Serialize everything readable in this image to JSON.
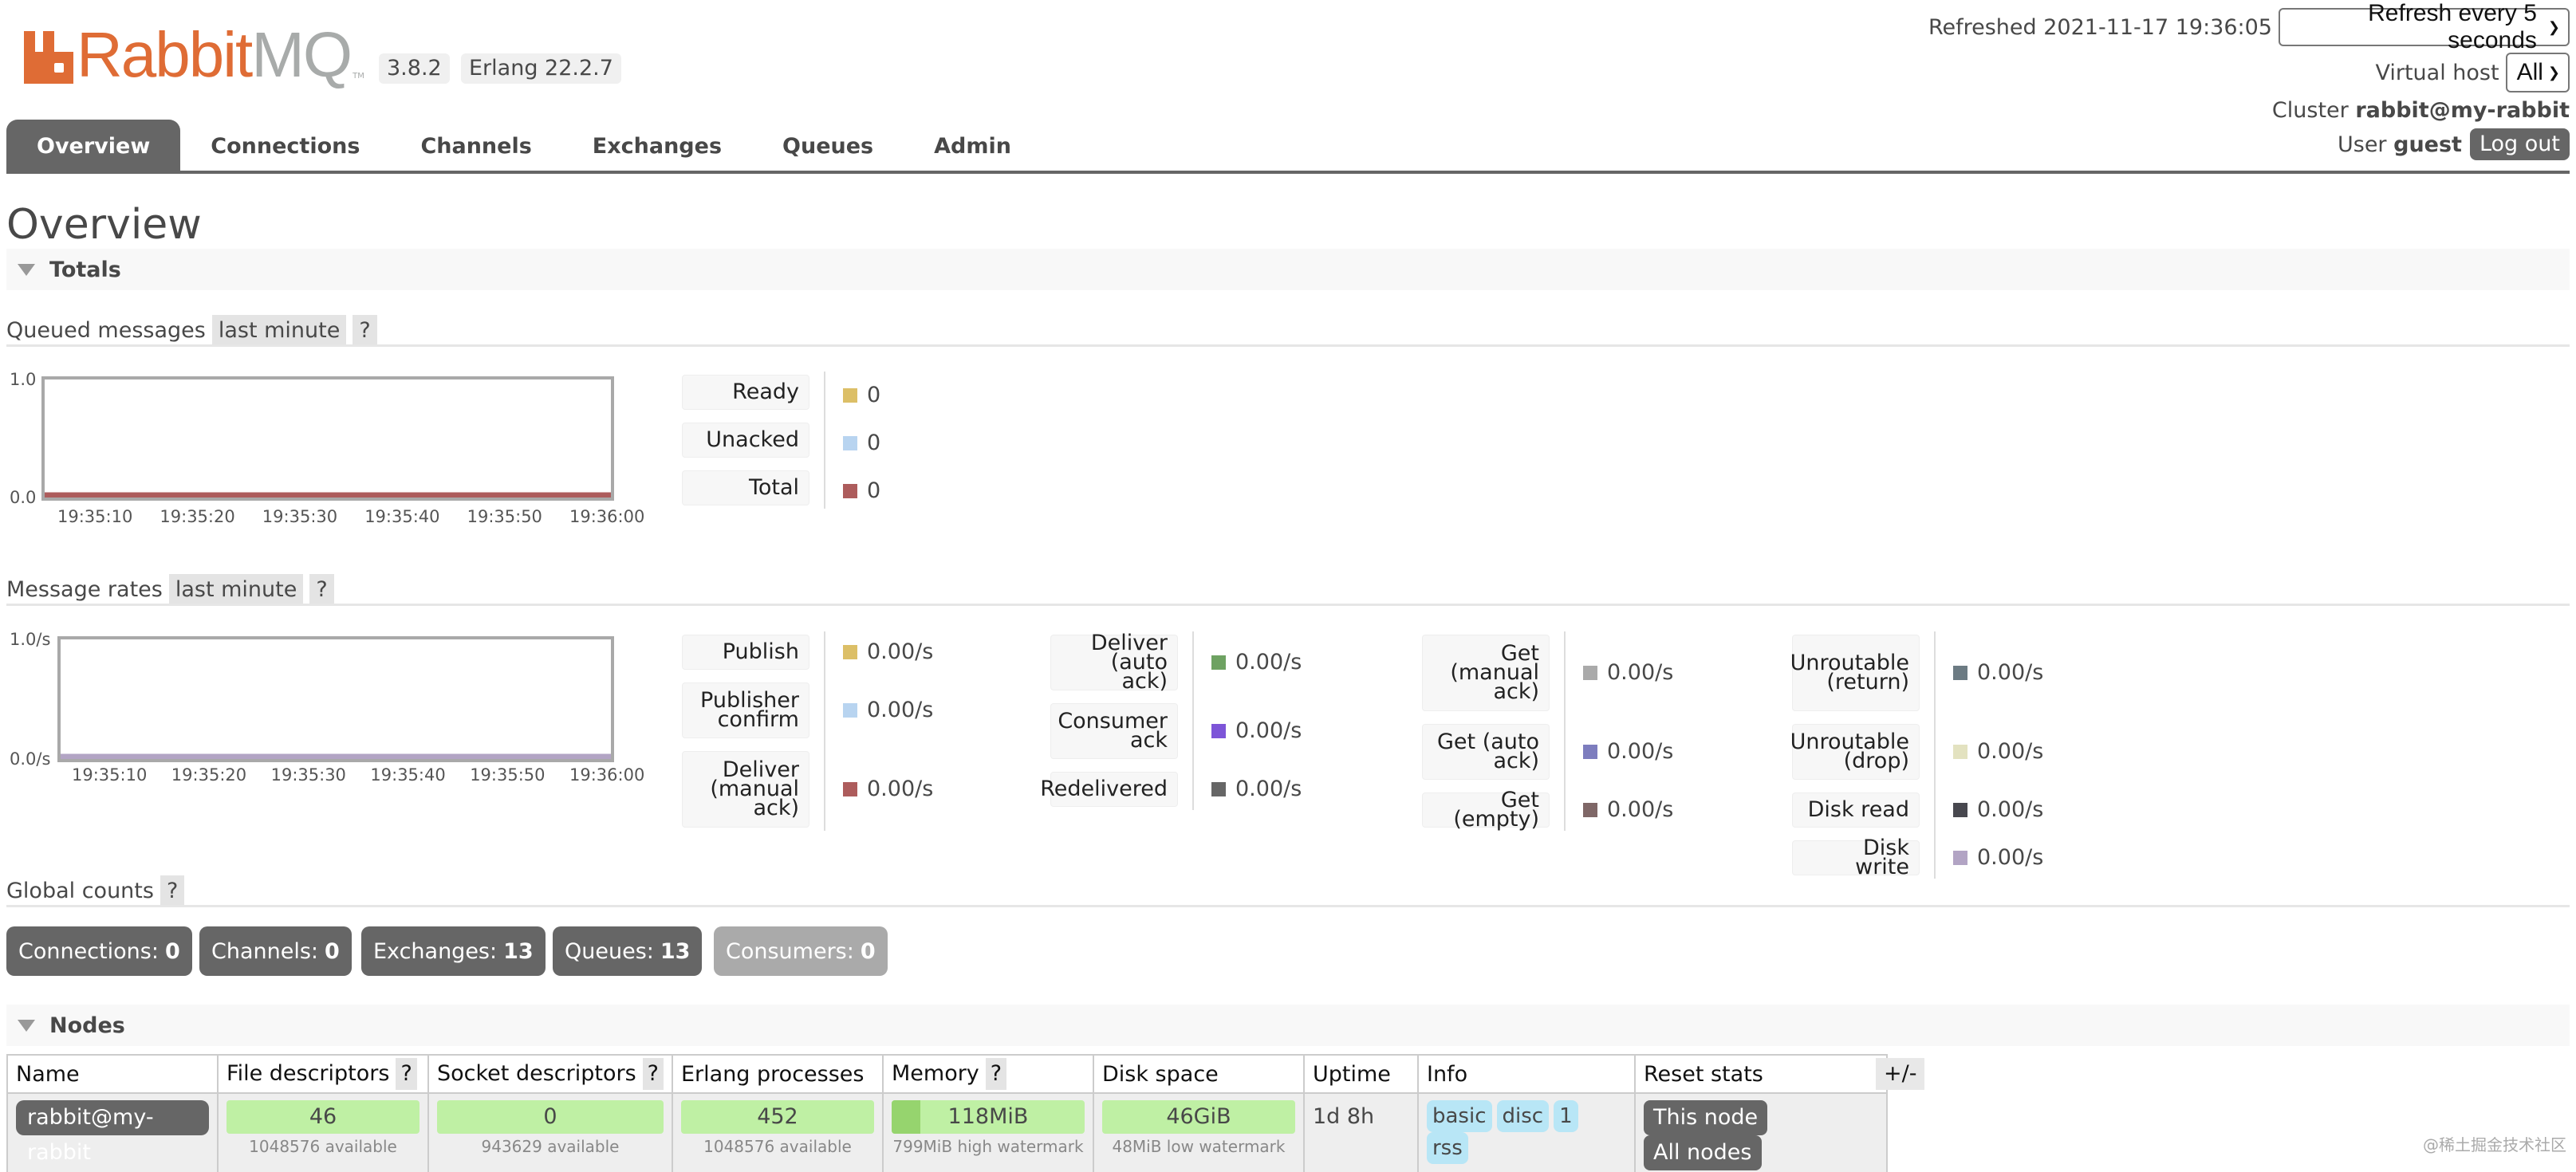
{
  "header": {
    "logo_primary": "Rabbit",
    "logo_secondary": "MQ",
    "logo_tm": "TM",
    "version": "3.8.2",
    "erlang": "Erlang 22.2.7",
    "refreshed": "Refreshed 2021-11-17 19:36:05",
    "refresh_select": "Refresh every 5 seconds",
    "vhost_label": "Virtual host",
    "vhost_select": "All",
    "cluster_label": "Cluster",
    "cluster_name": "rabbit@my-rabbit",
    "user_label": "User",
    "user_name": "guest",
    "logout": "Log out"
  },
  "nav": {
    "tabs": [
      {
        "label": "Overview",
        "active": true
      },
      {
        "label": "Connections"
      },
      {
        "label": "Channels"
      },
      {
        "label": "Exchanges"
      },
      {
        "label": "Queues"
      },
      {
        "label": "Admin"
      }
    ]
  },
  "page_title": "Overview",
  "totals": {
    "section_label": "Totals",
    "queued": {
      "title": "Queued messages",
      "range": "last minute",
      "help": "?",
      "y_top": "1.0",
      "y_bottom": "0.0",
      "x_ticks": [
        "19:35:10",
        "19:35:20",
        "19:35:30",
        "19:35:40",
        "19:35:50",
        "19:36:00"
      ],
      "legend": [
        {
          "label": "Ready",
          "value": "0",
          "color": "#dcbf67"
        },
        {
          "label": "Unacked",
          "value": "0",
          "color": "#b8d4f0"
        },
        {
          "label": "Total",
          "value": "0",
          "color": "#ad5c5c"
        }
      ]
    },
    "rates": {
      "title": "Message rates",
      "range": "last minute",
      "help": "?",
      "y_top": "1.0/s",
      "y_bottom": "0.0/s",
      "x_ticks": [
        "19:35:10",
        "19:35:20",
        "19:35:30",
        "19:35:40",
        "19:35:50",
        "19:36:00"
      ],
      "legend_groups": [
        [
          {
            "label": "Publish",
            "value": "0.00/s",
            "color": "#dcbf67"
          },
          {
            "label": "Publisher confirm",
            "value": "0.00/s",
            "color": "#b8d4f0"
          },
          {
            "label": "Deliver (manual ack)",
            "value": "0.00/s",
            "color": "#ad5c5c"
          }
        ],
        [
          {
            "label": "Deliver (auto ack)",
            "value": "0.00/s",
            "color": "#6ea262"
          },
          {
            "label": "Consumer ack",
            "value": "0.00/s",
            "color": "#7d55d8"
          },
          {
            "label": "Redelivered",
            "value": "0.00/s",
            "color": "#666666"
          }
        ],
        [
          {
            "label": "Get (manual ack)",
            "value": "0.00/s",
            "color": "#aaaaaa"
          },
          {
            "label": "Get (auto ack)",
            "value": "0.00/s",
            "color": "#7d7dbe"
          },
          {
            "label": "Get (empty)",
            "value": "0.00/s",
            "color": "#7f6767"
          }
        ],
        [
          {
            "label": "Unroutable (return)",
            "value": "0.00/s",
            "color": "#6c7b83"
          },
          {
            "label": "Unroutable (drop)",
            "value": "0.00/s",
            "color": "#e3e2c0"
          },
          {
            "label": "Disk read",
            "value": "0.00/s",
            "color": "#48484f"
          },
          {
            "label": "Disk write",
            "value": "0.00/s",
            "color": "#b2a4c4"
          }
        ]
      ]
    },
    "chart_data": [
      {
        "type": "line",
        "title": "Queued messages",
        "x": [
          "19:35:10",
          "19:35:20",
          "19:35:30",
          "19:35:40",
          "19:35:50",
          "19:36:00"
        ],
        "ylim": [
          0,
          1.0
        ],
        "series": [
          {
            "name": "Ready",
            "values": [
              0,
              0,
              0,
              0,
              0,
              0
            ]
          },
          {
            "name": "Unacked",
            "values": [
              0,
              0,
              0,
              0,
              0,
              0
            ]
          },
          {
            "name": "Total",
            "values": [
              0,
              0,
              0,
              0,
              0,
              0
            ]
          }
        ]
      },
      {
        "type": "line",
        "title": "Message rates",
        "x": [
          "19:35:10",
          "19:35:20",
          "19:35:30",
          "19:35:40",
          "19:35:50",
          "19:36:00"
        ],
        "ylim": [
          0,
          1.0
        ],
        "ylabel": "/s",
        "series": [
          {
            "name": "Publish",
            "values": [
              0,
              0,
              0,
              0,
              0,
              0
            ]
          },
          {
            "name": "Disk write",
            "values": [
              0,
              0,
              0,
              0,
              0,
              0
            ]
          }
        ]
      }
    ]
  },
  "global_counts": {
    "title": "Global counts",
    "help": "?",
    "items": [
      {
        "label": "Connections:",
        "value": "0"
      },
      {
        "label": "Channels:",
        "value": "0"
      },
      {
        "label": "Exchanges:",
        "value": "13"
      },
      {
        "label": "Queues:",
        "value": "13"
      },
      {
        "label": "Consumers:",
        "value": "0",
        "disabled": true
      }
    ]
  },
  "nodes": {
    "section_label": "Nodes",
    "columns": [
      "Name",
      "File descriptors",
      "Socket descriptors",
      "Erlang processes",
      "Memory",
      "Disk space",
      "Uptime",
      "Info",
      "Reset stats"
    ],
    "help": "?",
    "plus_minus": "+/-",
    "row": {
      "name": "rabbit@my-rabbit",
      "fd_used": "46",
      "fd_available": "1048576 available",
      "sd_used": "0",
      "sd_available": "943629 available",
      "proc_used": "452",
      "proc_available": "1048576 available",
      "mem_used": "118MiB",
      "mem_sub": "799MiB high watermark",
      "mem_fraction": 0.148,
      "disk_free": "46GiB",
      "disk_sub": "48MiB low watermark",
      "uptime": "1d 8h",
      "info": [
        "basic",
        "disc",
        "1",
        "rss"
      ],
      "reset": [
        "This node",
        "All nodes"
      ]
    }
  },
  "watermark": "@稀土掘金技术社区"
}
